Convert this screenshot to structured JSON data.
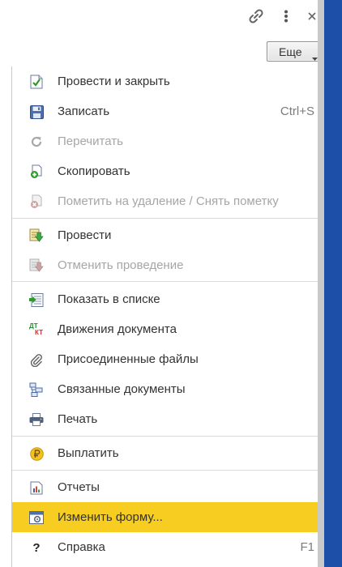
{
  "toolbar": {
    "more_label": "Еще",
    "icons": [
      "link-icon",
      "more-vertical-icon",
      "close-icon"
    ]
  },
  "menu": {
    "items": [
      {
        "label": "Провести и закрыть",
        "icon": "post-and-close-icon",
        "enabled": true
      },
      {
        "label": "Записать",
        "icon": "save-icon",
        "shortcut": "Ctrl+S",
        "enabled": true
      },
      {
        "label": "Перечитать",
        "icon": "reload-icon",
        "enabled": false
      },
      {
        "label": "Скопировать",
        "icon": "copy-icon",
        "enabled": true
      },
      {
        "label": "Пометить на удаление / Снять пометку",
        "icon": "mark-delete-icon",
        "enabled": false
      },
      {
        "label": "Провести",
        "icon": "post-icon",
        "enabled": true
      },
      {
        "label": "Отменить проведение",
        "icon": "unpost-icon",
        "enabled": false
      },
      {
        "label": "Показать в списке",
        "icon": "show-in-list-icon",
        "enabled": true
      },
      {
        "label": "Движения документа",
        "icon": "dt-kt-icon",
        "enabled": true
      },
      {
        "label": "Присоединенные файлы",
        "icon": "paperclip-icon",
        "enabled": true
      },
      {
        "label": "Связанные документы",
        "icon": "related-docs-icon",
        "enabled": true
      },
      {
        "label": "Печать",
        "icon": "printer-icon",
        "enabled": true
      },
      {
        "label": "Выплатить",
        "icon": "ruble-coin-icon",
        "enabled": true
      },
      {
        "label": "Отчеты",
        "icon": "reports-icon",
        "enabled": true
      },
      {
        "label": "Изменить форму...",
        "icon": "change-form-icon",
        "enabled": true,
        "highlighted": true
      },
      {
        "label": "Справка",
        "icon": "help-icon",
        "shortcut": "F1",
        "enabled": true
      }
    ],
    "dtkt_icon": {
      "top": "ДТ",
      "bottom": "КТ"
    },
    "help_icon_glyph": "?"
  },
  "colors": {
    "highlight": "#f7cd22",
    "disabled_text": "#a6a6a6",
    "side_panel_blue": "#1d4fa8"
  }
}
